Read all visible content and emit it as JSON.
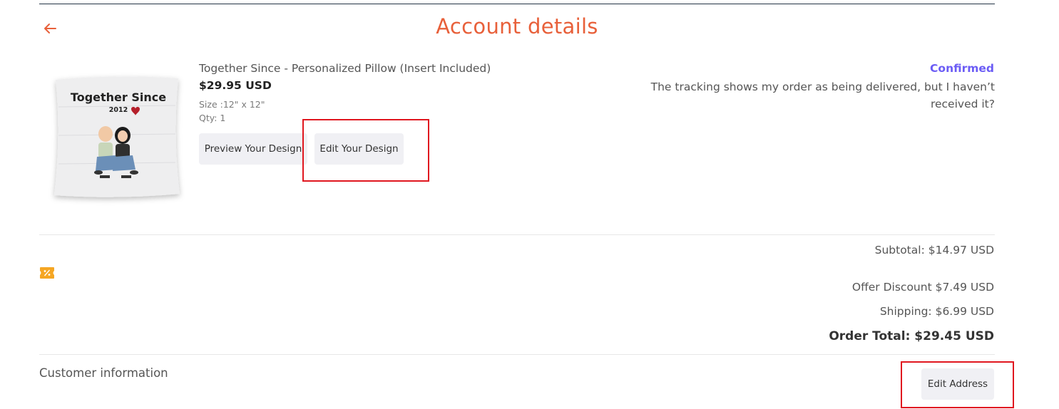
{
  "page": {
    "title": "Account details"
  },
  "product": {
    "name": "Together Since - Personalized Pillow (Insert Included)",
    "price": "$29.95 USD",
    "size": "Size :12\" x 12\"",
    "qty": "Qty: 1",
    "image_text": {
      "heading": "Together Since",
      "year": "2012"
    }
  },
  "buttons": {
    "preview": "Preview Your Design",
    "edit": "Edit Your Design",
    "edit_address": "Edit Address"
  },
  "order_status": {
    "status": "Confirmed",
    "note": "The tracking shows my order as being delivered, but I haven’t received it?"
  },
  "totals": {
    "subtotal": "Subtotal: $14.97 USD",
    "offer_discount": "Offer Discount $7.49 USD",
    "shipping": "Shipping: $6.99 USD",
    "order_total": "Order Total: $29.45 USD"
  },
  "customer": {
    "heading": "Customer information"
  },
  "colors": {
    "accent": "#e8603a",
    "status": "#6b5cf5",
    "highlight": "#e0171f",
    "coupon": "#f5a623"
  },
  "icons": {
    "back": "arrow-left-icon",
    "coupon": "discount-ticket-icon"
  }
}
